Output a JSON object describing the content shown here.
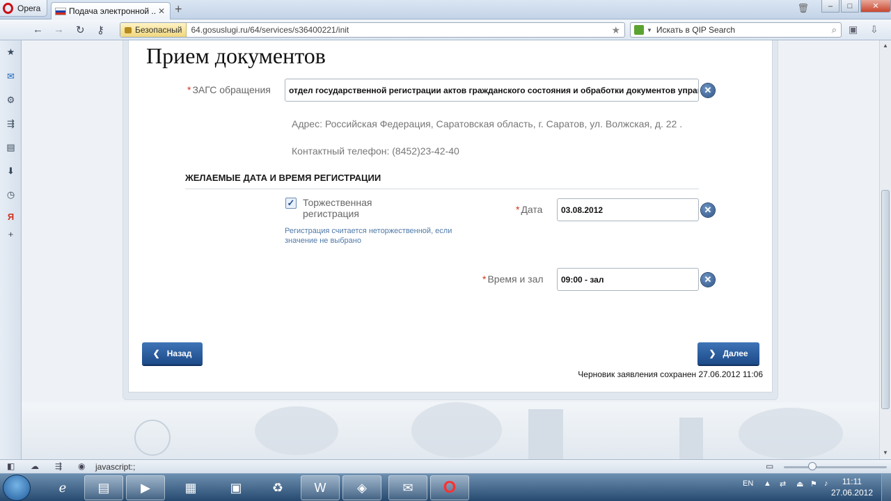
{
  "browser": {
    "menu_label": "Opera",
    "tab_title": "Подача электронной ...",
    "tab_close": "✕",
    "new_tab": "+",
    "secure_label": "Безопасный",
    "url": "64.gosuslugi.ru/64/services/s36400221/init",
    "search_placeholder": "Искать в QIP Search"
  },
  "window_controls": {
    "minimize": "–",
    "maximize": "□",
    "close": "✕"
  },
  "page": {
    "title": "Прием документов",
    "zags": {
      "label": "ЗАГС обращения",
      "value": "отдел государственной регистрации актов гражданского состояния и обработки документов управл",
      "address": "Адрес: Российская Федерация, Саратовская область, г. Саратов, ул. Волжская, д. 22 .",
      "phone": "Контактный телефон: (8452)23-42-40"
    },
    "section_title": "ЖЕЛАЕМЫЕ ДАТА И ВРЕМЯ РЕГИСТРАЦИИ",
    "solemn": {
      "label": "Торжественная регистрация",
      "checked": true,
      "hint": "Регистрация считается неторжественной, если значение не выбрано"
    },
    "date": {
      "label": "Дата",
      "value": "03.08.2012"
    },
    "time": {
      "label": "Время и зал",
      "value": "09:00 - зал"
    },
    "required_mark": "*",
    "back_button": "Назад",
    "next_button": "Далее",
    "draft_saved": "Черновик заявления сохранен 27.06.2012 11:06"
  },
  "status_bar": {
    "text": "javascript:;"
  },
  "taskbar": {
    "language": "EN",
    "time": "11:11",
    "date": "27.06.2012",
    "apps": [
      "internet-explorer",
      "file-explorer",
      "media-player",
      "office-tools",
      "scanner",
      "recycle",
      "word",
      "virtualbox",
      "thunderbird",
      "opera"
    ]
  },
  "colors": {
    "accent": "#2a5a98",
    "required": "#d0321e",
    "hint": "#4f79a8",
    "opera_red": "#cc0f16"
  },
  "icons": {
    "sidebar": [
      "bookmarks-star-icon",
      "mail-icon",
      "widgets-gear-icon",
      "unite-share-icon",
      "notes-icon",
      "downloads-icon",
      "history-clock-icon",
      "yandex-icon",
      "add-panel-icon"
    ],
    "clear": "clear-x-icon"
  }
}
